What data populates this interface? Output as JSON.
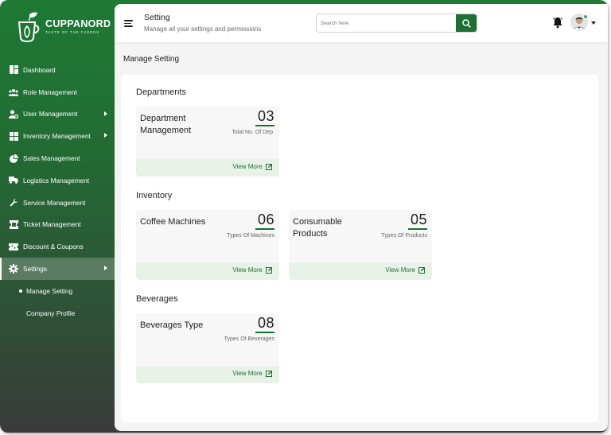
{
  "brand": {
    "name": "CUPPANORD",
    "tagline": "TASTE OF THE FJORDS"
  },
  "sidebar": {
    "items": [
      {
        "label": "Dashboard",
        "icon": "dashboard-icon"
      },
      {
        "label": "Role Management",
        "icon": "users-group-icon"
      },
      {
        "label": "User Management",
        "icon": "user-gear-icon",
        "expandable": true
      },
      {
        "label": "Inventory Management",
        "icon": "boxes-icon",
        "expandable": true
      },
      {
        "label": "Sales Management",
        "icon": "pie-chart-icon"
      },
      {
        "label": "Logistics Management",
        "icon": "truck-icon"
      },
      {
        "label": "Service Management",
        "icon": "wrench-icon"
      },
      {
        "label": "Ticket Management",
        "icon": "ticket-icon"
      },
      {
        "label": "Discount & Coupons",
        "icon": "coupon-icon"
      },
      {
        "label": "Settings",
        "icon": "gear-icon",
        "expandable": true,
        "active": true
      }
    ],
    "sub_items": [
      {
        "label": "Manage Setting",
        "active": true
      },
      {
        "label": "Company Profile"
      }
    ]
  },
  "header": {
    "title": "Setting",
    "subtitle": "Manage all your settings and permissions",
    "search_placeholder": "Search here"
  },
  "main": {
    "section_title": "Manage Setting",
    "groups": [
      {
        "title": "Departments",
        "tiles": [
          {
            "name": "Department Management",
            "count": "03",
            "desc": "Total No. Of Dep.",
            "action": "View More"
          }
        ]
      },
      {
        "title": "Inventory",
        "tiles": [
          {
            "name": "Coffee Machines",
            "count": "06",
            "desc": "Types Of Machines",
            "action": "View More"
          },
          {
            "name": "Consumable Products",
            "count": "05",
            "desc": "Types Of Products",
            "action": "View More"
          }
        ]
      },
      {
        "title": "Beverages",
        "tiles": [
          {
            "name": "Beverages Type",
            "count": "08",
            "desc": "Types Of Beverages",
            "action": "View More"
          }
        ]
      }
    ]
  },
  "colors": {
    "brand_green": "#1e6e35",
    "tile_footer": "#e9f2e9",
    "online": "#2fb34a"
  }
}
